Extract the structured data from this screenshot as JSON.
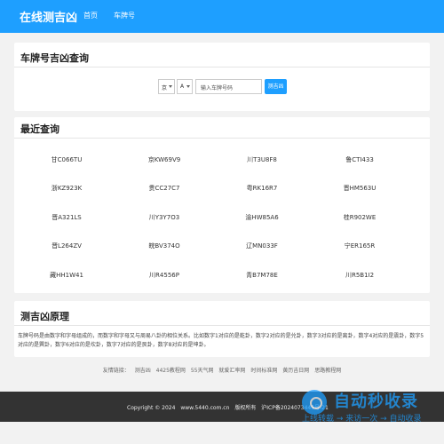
{
  "header": {
    "logo": "在线测吉凶",
    "nav": [
      "首页",
      "车牌号"
    ]
  },
  "query": {
    "title": "车牌号吉凶查询",
    "province": "京",
    "letter": "A",
    "input_placeholder": "输入车牌号码",
    "button": "测吉凶"
  },
  "recent": {
    "title": "最近查询",
    "rows": [
      [
        "甘C066TU",
        "京KW69V9",
        "川T3U8F8",
        "鲁CTI433"
      ],
      [
        "浙KZ923K",
        "贵CC27C7",
        "粤RK16R7",
        "晋HM563U"
      ],
      [
        "晋A321LS",
        "川Y3Y7O3",
        "渝HW85A6",
        "桂R902WE"
      ],
      [
        "晋L264ZV",
        "皖BV374O",
        "辽MN033F",
        "宁ER165R"
      ],
      [
        "藏HH1W41",
        "川R4556P",
        "青B7M78E",
        "川R5B1I2"
      ]
    ]
  },
  "principle": {
    "title": "测吉凶原理",
    "text": "车牌号码是由数字和字母组成的，而数字和字母又与周易八卦的相位关系。比如数字1对应的是乾卦，数字2对应的是兑卦，数字3对应的是离卦，数字4对应的是震卦，数字5对应的是巽卦，数字6对应的是坎卦，数字7对应的是艮卦，数字8对应的是坤卦。"
  },
  "friends": {
    "label": "友情链接：",
    "links": [
      "测吉凶",
      "4425教程网",
      "55天气网",
      "就爱汇率网",
      "时间标准网",
      "黄历吉日网",
      "思路教程网"
    ]
  },
  "footer": {
    "copyright": "Copyright © 2024",
    "site": "www.5440.com.cn",
    "rights": "版权所有",
    "icp": "沪ICP备2024073445号-21"
  },
  "watermark": {
    "title": "自动秒收录",
    "subtitle": "上线转载 → 来访一次 → 自动收录"
  }
}
